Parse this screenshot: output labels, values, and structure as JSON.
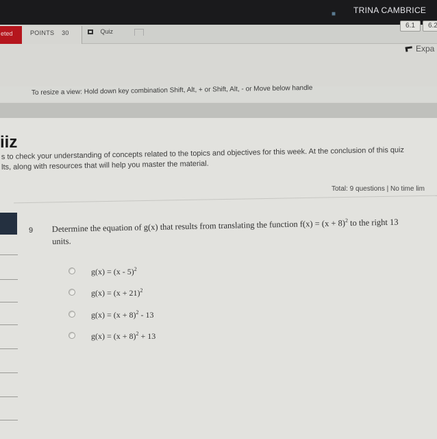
{
  "header": {
    "user_name": "TRINA CAMBRICE"
  },
  "tabs": {
    "red_tab_label": "eted",
    "points_label": "POINTS",
    "points_value": "30",
    "quiz_label": "Quiz"
  },
  "page_chips": [
    "6.1",
    "6.2"
  ],
  "expand_label": "Expa",
  "resize_hint": "To resize a view: Hold down key combination Shift, Alt, + or Shift, Alt, - or Move below handle",
  "quiz": {
    "title": "iiz",
    "description_line1": "s to check your understanding of concepts related to the topics and objectives for this week. At the conclusion of this quiz",
    "description_line2": "lts, along with resources that will help you master the material.",
    "total_info": "Total: 9 questions | No time lim"
  },
  "question": {
    "number": "9",
    "text_pre": "Determine the equation of g(x) that results from translating the function f(x) = (x + 8)",
    "text_exp": "2",
    "text_post": " to the right 13",
    "text_line2": "units.",
    "options": [
      {
        "pre": "g(x) = (x - 5)",
        "exp": "2",
        "post": ""
      },
      {
        "pre": "g(x) = (x + 21)",
        "exp": "2",
        "post": ""
      },
      {
        "pre": "g(x) = (x + 8)",
        "exp": "2",
        "post": " - 13"
      },
      {
        "pre": "g(x) = (x + 8)",
        "exp": "2",
        "post": " + 13"
      }
    ]
  }
}
